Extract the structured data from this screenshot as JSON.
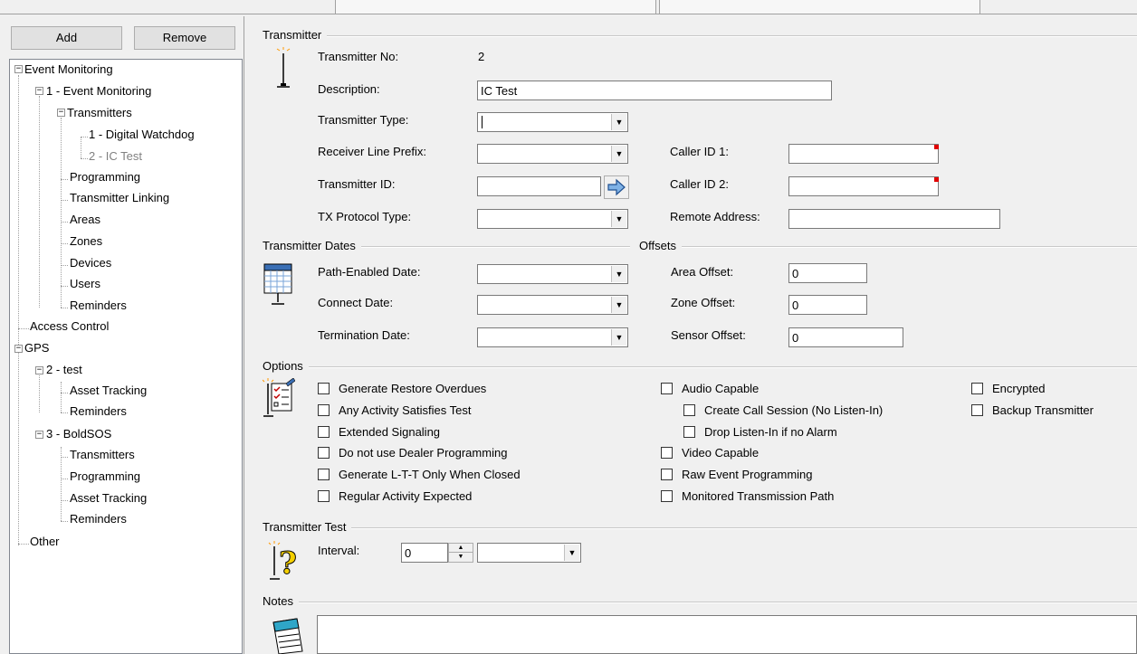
{
  "toolbar": {
    "add_label": "Add",
    "remove_label": "Remove"
  },
  "tree": {
    "event_monitoring": "Event Monitoring",
    "event_monitoring_1": "1 - Event Monitoring",
    "transmitters": "Transmitters",
    "tx_1": "1 - Digital Watchdog",
    "tx_2": "2 - IC Test",
    "programming": "Programming",
    "transmitter_linking": "Transmitter Linking",
    "areas": "Areas",
    "zones": "Zones",
    "devices": "Devices",
    "users": "Users",
    "reminders": "Reminders",
    "access_control": "Access Control",
    "gps": "GPS",
    "gps_2": "2 - test",
    "asset_tracking": "Asset Tracking",
    "reminders_2": "Reminders",
    "gps_3": "3 - BoldSOS",
    "transmitters_3": "Transmitters",
    "programming_3": "Programming",
    "asset_tracking_3": "Asset Tracking",
    "reminders_3": "Reminders",
    "other": "Other"
  },
  "transmitter": {
    "group_title": "Transmitter",
    "no_label": "Transmitter No:",
    "no_value": "2",
    "description_label": "Description:",
    "description_value": "IC Test",
    "type_label": "Transmitter Type:",
    "type_value": "",
    "receiver_prefix_label": "Receiver Line Prefix:",
    "receiver_prefix_value": "",
    "tx_id_label": "Transmitter ID:",
    "tx_id_value": "",
    "protocol_label": "TX Protocol Type:",
    "protocol_value": "",
    "caller_id1_label": "Caller ID 1:",
    "caller_id1_value": "",
    "caller_id2_label": "Caller ID 2:",
    "caller_id2_value": "",
    "remote_address_label": "Remote Address:",
    "remote_address_value": ""
  },
  "dates": {
    "group_title": "Transmitter Dates",
    "path_enabled_label": "Path-Enabled Date:",
    "connect_label": "Connect Date:",
    "termination_label": "Termination Date:"
  },
  "offsets": {
    "group_title": "Offsets",
    "area_label": "Area Offset:",
    "area_value": "0",
    "zone_label": "Zone Offset:",
    "zone_value": "0",
    "sensor_label": "Sensor Offset:",
    "sensor_value": "0"
  },
  "options": {
    "group_title": "Options",
    "col1": [
      "Generate Restore Overdues",
      "Any Activity Satisfies Test",
      "Extended Signaling",
      "Do not use Dealer Programming",
      "Generate L-T-T Only When Closed",
      "Regular Activity Expected"
    ],
    "audio_capable": "Audio Capable",
    "create_call_session": "Create Call Session (No Listen-In)",
    "drop_listen_in": "Drop Listen-In if no Alarm",
    "video_capable": "Video Capable",
    "raw_event_programming": "Raw Event Programming",
    "monitored_transmission_path": "Monitored Transmission Path",
    "encrypted": "Encrypted",
    "backup_transmitter": "Backup Transmitter"
  },
  "test": {
    "group_title": "Transmitter Test",
    "interval_label": "Interval:",
    "interval_value": "0",
    "interval_unit": ""
  },
  "notes": {
    "group_title": "Notes",
    "value": ""
  },
  "icons": [
    "antenna-icon",
    "calendar-icon",
    "options-checklist-icon",
    "question-antenna-icon",
    "notepad-icon",
    "arrow-right-icon"
  ]
}
